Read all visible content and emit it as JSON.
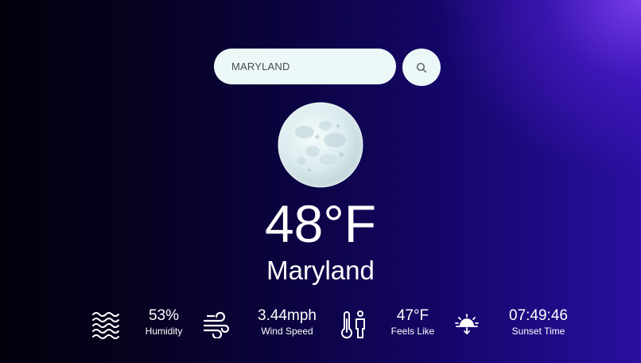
{
  "search": {
    "value": "MARYLAND",
    "placeholder": "",
    "button_icon": "search-icon"
  },
  "weather": {
    "icon": "full-moon-icon",
    "temperature": "48°F",
    "city": "Maryland"
  },
  "stats": {
    "humidity": {
      "icon": "waves-icon",
      "value": "53%",
      "label": "Humidity"
    },
    "wind": {
      "icon": "wind-icon",
      "value": "3.44mph",
      "label": "Wind Speed"
    },
    "feels_like": {
      "icon": "thermometer-person-icon",
      "value": "47°F",
      "label": "Feels Like"
    },
    "sunset": {
      "icon": "sunset-icon",
      "value": "07:49:46",
      "label": "Sunset Time"
    }
  },
  "colors": {
    "search_bg": "#ecf8f8",
    "background_dark": "#02010c",
    "background_accent": "#7a3eec",
    "text": "#ffffff"
  }
}
